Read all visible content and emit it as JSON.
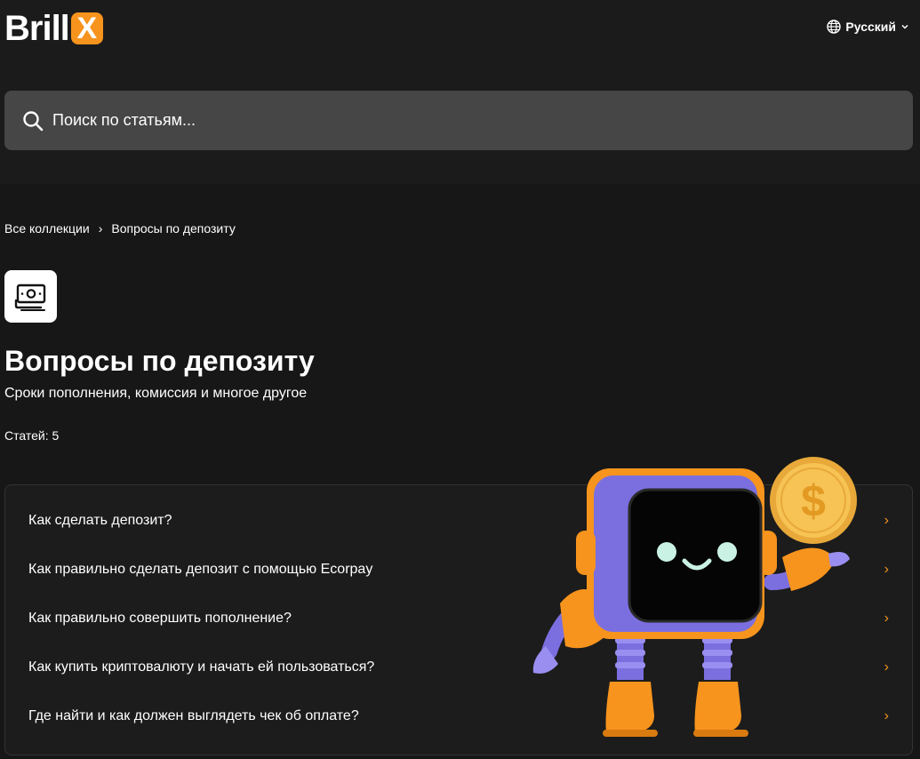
{
  "brand": {
    "logo_text": "Brill",
    "logo_x": "X",
    "accent_color": "#f7941d"
  },
  "header": {
    "language": "Русский",
    "language_icon": "globe-icon",
    "dropdown_icon": "chevron-down-icon"
  },
  "search": {
    "placeholder": "Поиск по статьям...",
    "value": "",
    "icon": "search-icon"
  },
  "breadcrumb": {
    "root": "Все коллекции",
    "separator": "›",
    "current": "Вопросы по депозиту"
  },
  "collection": {
    "icon": "money-icon",
    "title": "Вопросы по депозиту",
    "description": "Сроки пополнения, комиссия и многое другое",
    "count_text": "Статей: 5"
  },
  "articles": [
    {
      "title": "Как сделать депозит?"
    },
    {
      "title": "Как правильно сделать депозит с помощью Ecorpay"
    },
    {
      "title": "Как правильно совершить пополнение?"
    },
    {
      "title": "Как купить криптовалюту и начать ей пользоваться?"
    },
    {
      "title": "Где найти и как должен выглядеть чек об оплате?"
    }
  ],
  "article_chevron": "›"
}
